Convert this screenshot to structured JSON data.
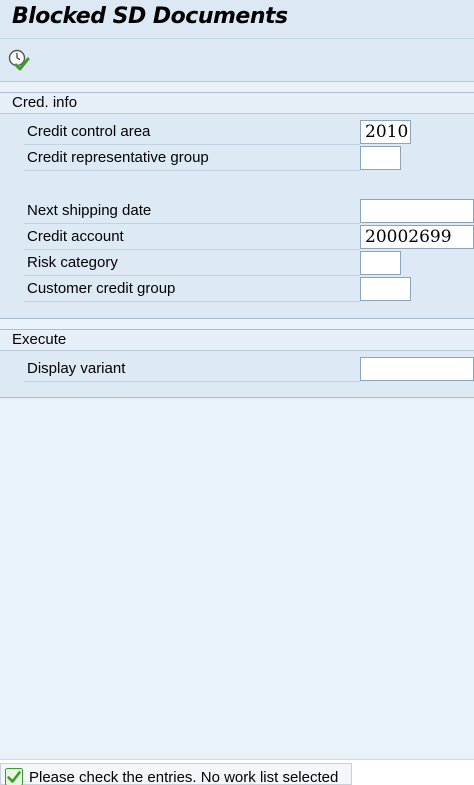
{
  "window": {
    "title": "Blocked SD Documents"
  },
  "toolbar": {
    "execute_icon": "execute-clock-check-icon"
  },
  "groups": {
    "cred_info": {
      "title": "Cred. info",
      "rows": [
        {
          "label": "Credit control area",
          "value": "2010"
        },
        {
          "label": "Credit representative group",
          "value": ""
        },
        {
          "label": "Next shipping date",
          "value": ""
        },
        {
          "label": "Credit account",
          "value": "20002699"
        },
        {
          "label": "Risk category",
          "value": ""
        },
        {
          "label": "Customer credit group",
          "value": ""
        }
      ]
    },
    "execute": {
      "title": "Execute",
      "rows": [
        {
          "label": "Display variant",
          "value": ""
        }
      ]
    }
  },
  "status": {
    "icon": "success-check-icon",
    "message": "Please check the entries. No work list selected"
  },
  "colors": {
    "background": "#e9f2f9",
    "group_background": "#dde9f4",
    "success_green": "#3c9a2a"
  }
}
